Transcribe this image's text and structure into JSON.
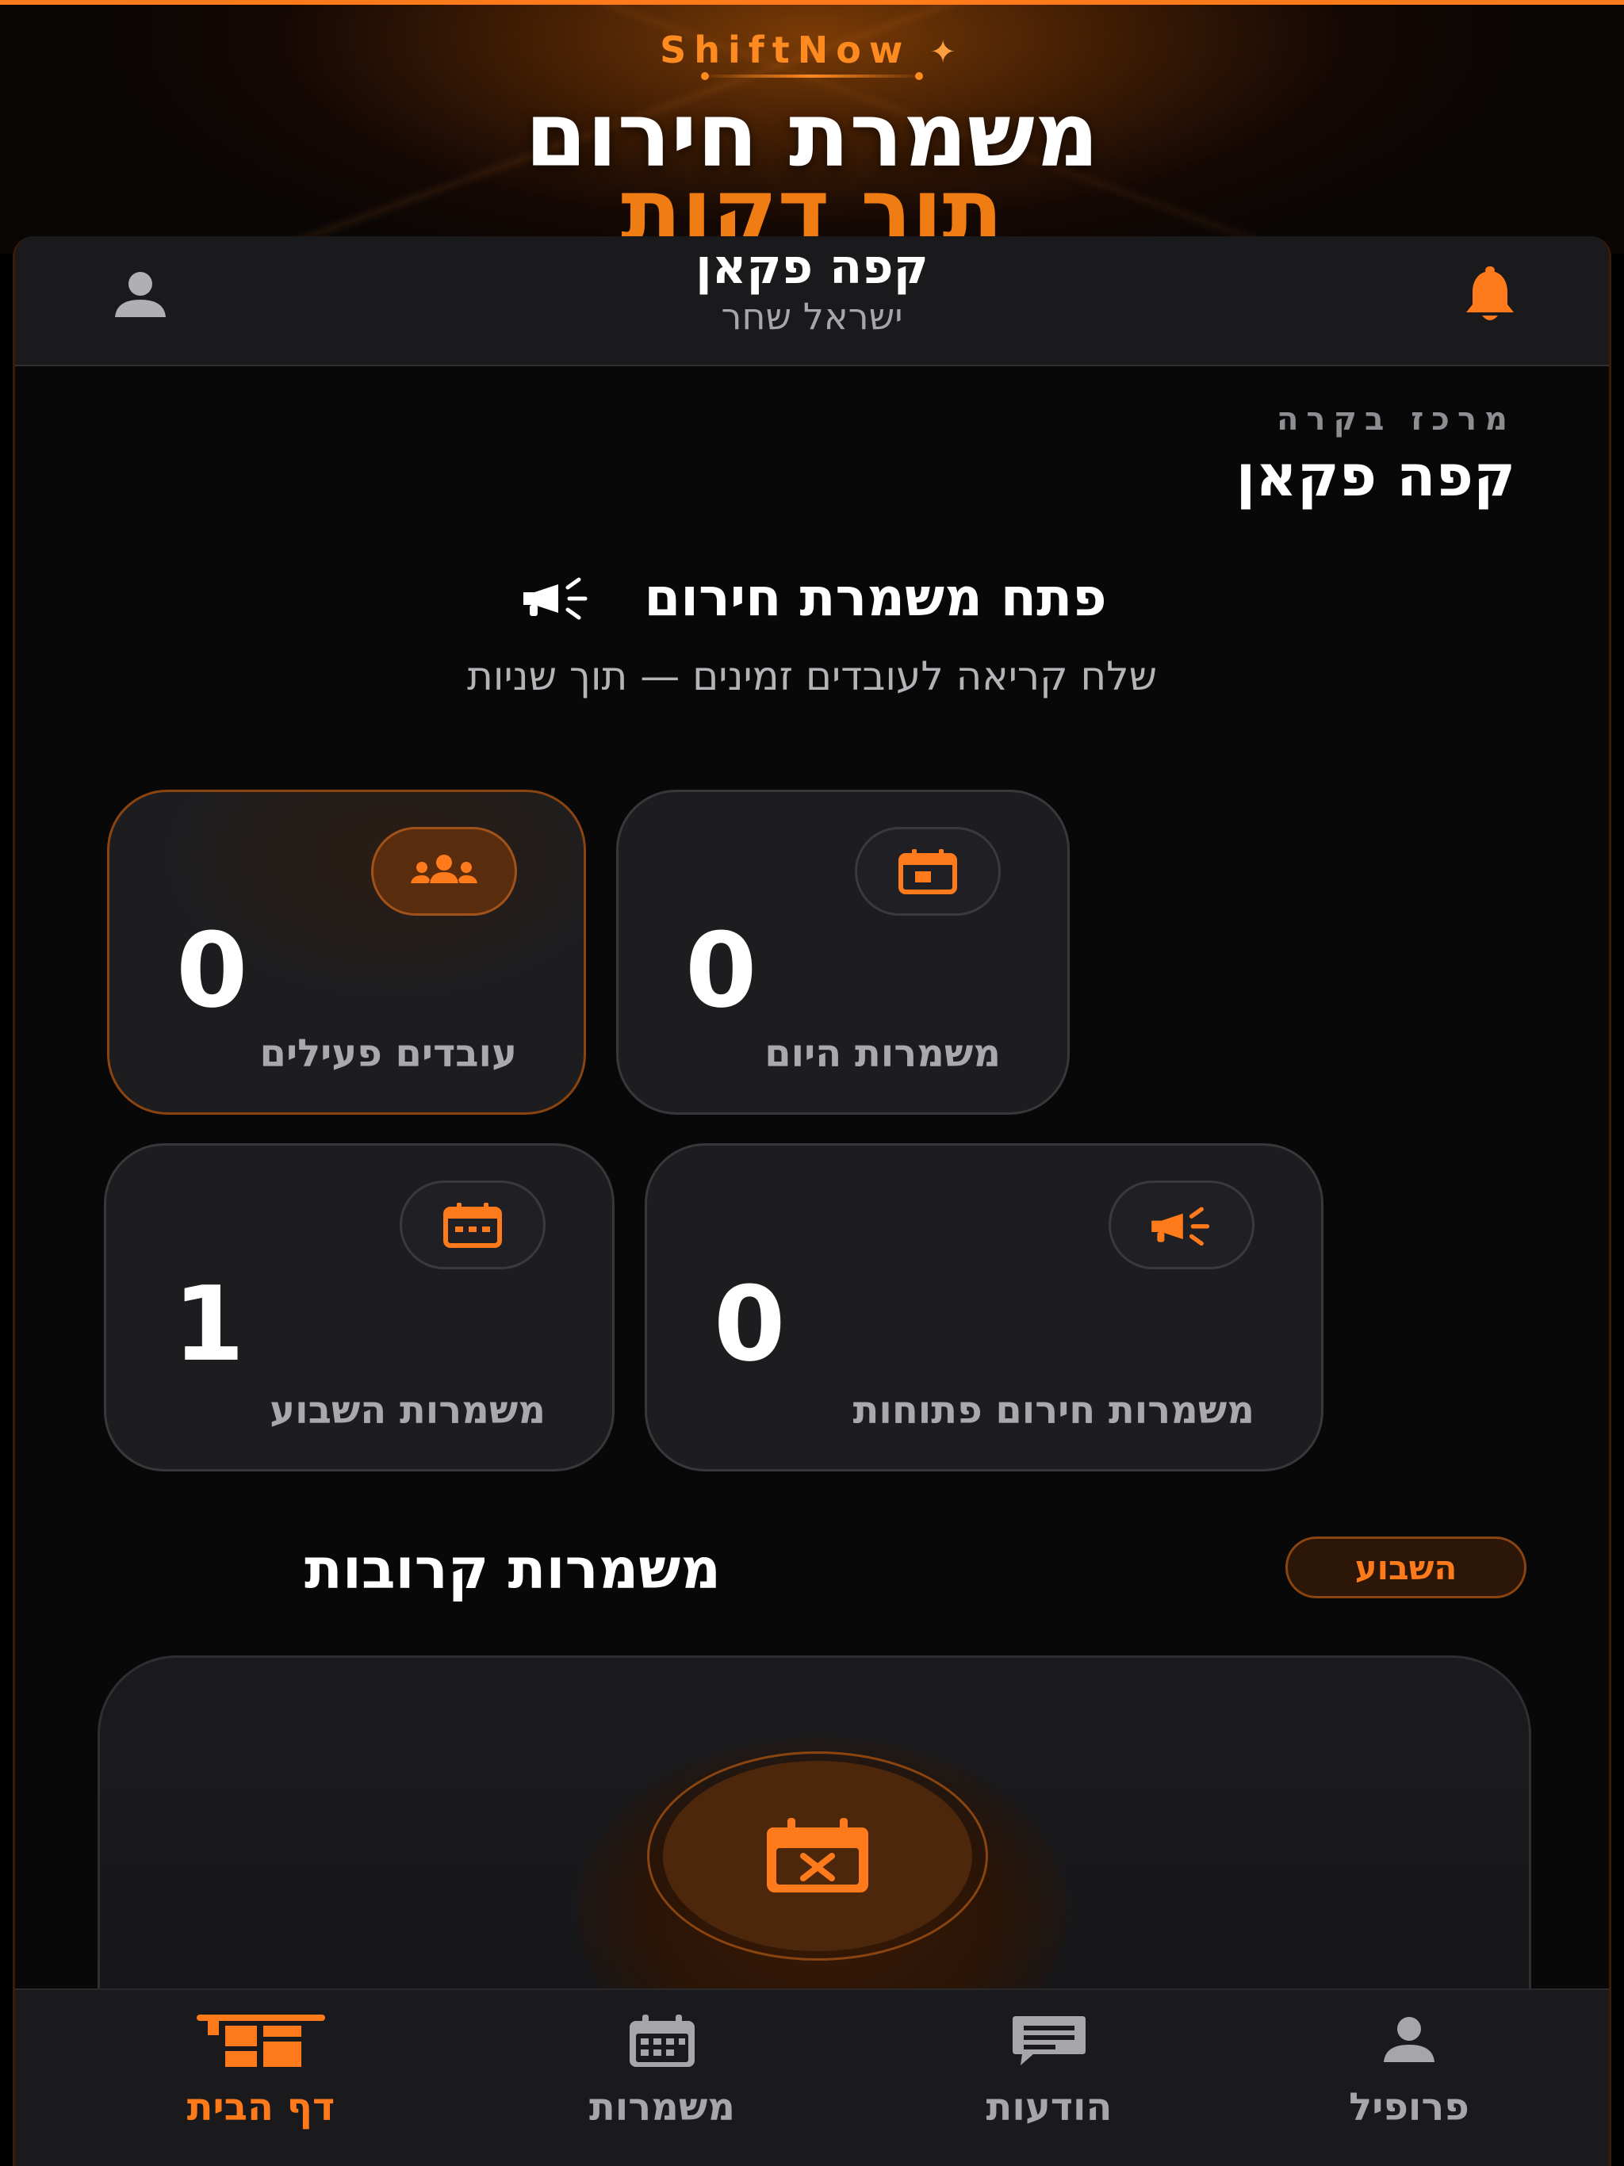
{
  "banner": {
    "brand": "ShiftNow",
    "brand_mark": "✦",
    "headline_line1": "משמרת חירום",
    "headline_line2": "תוך דקות"
  },
  "topbar": {
    "business_name": "קפה פקאן",
    "user_name": "ישראל שחר",
    "icons": {
      "left": "user-icon",
      "right": "bell-icon"
    }
  },
  "dashboard": {
    "eyebrow": "מרכז בקרה",
    "business_name": "קפה פקאן",
    "emergency_button": "פתח משמרת חירום",
    "emergency_subtitle": "שלח קריאה לעובדים זמינים — תוך שניות"
  },
  "stats": [
    {
      "label": "עובדים פעילים",
      "value": "0",
      "icon": "users-icon",
      "active": true
    },
    {
      "label": "משמרות היום",
      "value": "0",
      "icon": "calendar-day-icon",
      "active": false
    },
    {
      "label": "משמרות השבוע",
      "value": "1",
      "icon": "calendar-week-icon",
      "active": false
    },
    {
      "label": "משמרות חירום פתוחות",
      "value": "0",
      "icon": "megaphone-icon",
      "active": false
    }
  ],
  "upcoming": {
    "title": "משמרות קרובות",
    "filter": "השבוע",
    "empty_icon": "calendar-x-icon"
  },
  "nav": [
    {
      "label": "דף הבית",
      "icon": "dashboard-icon",
      "active": true
    },
    {
      "label": "משמרות",
      "icon": "calendar-icon",
      "active": false
    },
    {
      "label": "הודעות",
      "icon": "chat-icon",
      "active": false
    },
    {
      "label": "פרופיל",
      "icon": "user-icon",
      "active": false
    }
  ],
  "colors": {
    "accent": "#ff7a1a",
    "background": "#080808",
    "card": "#1d1d20",
    "muted_text": "#a6a6aa"
  }
}
